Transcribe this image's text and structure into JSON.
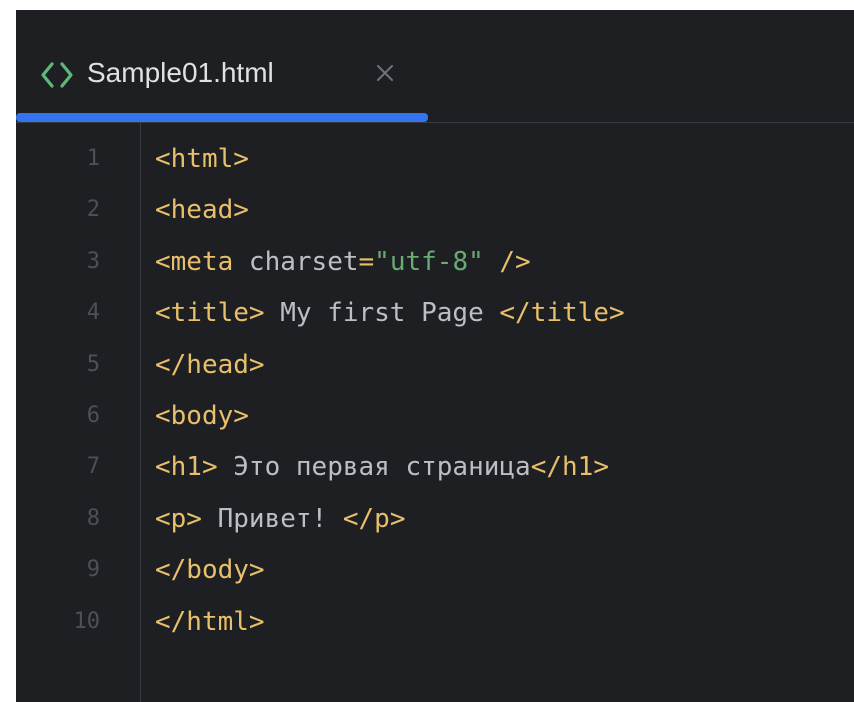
{
  "tab": {
    "icon": "html-file-icon",
    "label": "Sample01.html",
    "close_icon": "close-icon",
    "active": true
  },
  "lines": [
    {
      "num": "1",
      "tokens": [
        {
          "t": "tag",
          "v": "<html>"
        }
      ]
    },
    {
      "num": "2",
      "tokens": [
        {
          "t": "tag",
          "v": "<head>"
        }
      ]
    },
    {
      "num": "3",
      "tokens": [
        {
          "t": "tag",
          "v": "<meta"
        },
        {
          "t": "attr",
          "v": " charset"
        },
        {
          "t": "eq",
          "v": "="
        },
        {
          "t": "str",
          "v": "\"utf-8\""
        },
        {
          "t": "tag",
          "v": " />"
        }
      ]
    },
    {
      "num": "4",
      "tokens": [
        {
          "t": "tag",
          "v": "<title>"
        },
        {
          "t": "text",
          "v": " My first Page "
        },
        {
          "t": "tag",
          "v": "</title>"
        }
      ]
    },
    {
      "num": "5",
      "tokens": [
        {
          "t": "tag",
          "v": "</head>"
        }
      ]
    },
    {
      "num": "6",
      "tokens": [
        {
          "t": "tag",
          "v": "<body>"
        }
      ]
    },
    {
      "num": "7",
      "tokens": [
        {
          "t": "tag",
          "v": "<h1>"
        },
        {
          "t": "text",
          "v": " Это первая страница"
        },
        {
          "t": "tag",
          "v": "</h1>"
        }
      ]
    },
    {
      "num": "8",
      "tokens": [
        {
          "t": "tag",
          "v": "<p>"
        },
        {
          "t": "text",
          "v": " Привет! "
        },
        {
          "t": "tag",
          "v": "</p>"
        }
      ]
    },
    {
      "num": "9",
      "tokens": [
        {
          "t": "tag",
          "v": "</body>"
        }
      ]
    },
    {
      "num": "10",
      "tokens": [
        {
          "t": "tag",
          "v": "</html>"
        }
      ]
    }
  ],
  "colors": {
    "background": "#1e1f22",
    "tag": "#e8bf6a",
    "string": "#6aab73",
    "text": "#bcbec4",
    "line_number": "#4b5059",
    "tab_underline": "#3574f0"
  }
}
